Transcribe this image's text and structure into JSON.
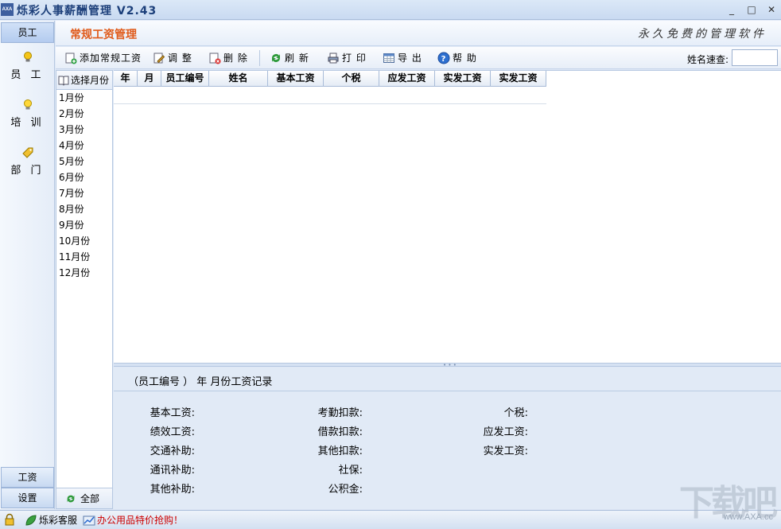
{
  "app": {
    "logo_text": "AXA",
    "title": "烁彩人事薪酬管理 V2.43",
    "minimize": "_",
    "restore": "□",
    "close": "✕"
  },
  "leftnav": {
    "top_group": "员工",
    "items": [
      {
        "label": "员 工",
        "icon": "person-bulb-icon"
      },
      {
        "label": "培 训",
        "icon": "bulb-icon"
      },
      {
        "label": "部 门",
        "icon": "tag-icon"
      }
    ],
    "bottom_groups": [
      "工资",
      "设置"
    ]
  },
  "module": {
    "title": "常规工资管理",
    "slogan": "永久免费的管理软件"
  },
  "toolbar": {
    "buttons": [
      {
        "label": "添加常规工资",
        "icon": "add-document-icon"
      },
      {
        "label": "调 整",
        "icon": "edit-icon"
      },
      {
        "label": "删 除",
        "icon": "delete-icon"
      },
      {
        "label": "刷 新",
        "icon": "refresh-icon"
      },
      {
        "label": "打 印",
        "icon": "printer-icon"
      },
      {
        "label": "导 出",
        "icon": "export-icon"
      },
      {
        "label": "帮 助",
        "icon": "help-icon"
      }
    ],
    "search_label": "姓名速查:",
    "search_value": ""
  },
  "months": {
    "header": "选择月份",
    "items": [
      "1月份",
      "2月份",
      "3月份",
      "4月份",
      "5月份",
      "6月份",
      "7月份",
      "8月份",
      "9月份",
      "10月份",
      "11月份",
      "12月份"
    ],
    "all_label": "全部"
  },
  "grid": {
    "columns": [
      "年",
      "月",
      "员工编号",
      "姓名",
      "基本工资",
      "个税",
      "应发工资",
      "实发工资",
      "实发工资"
    ],
    "rows": []
  },
  "detail": {
    "title": "（员工编号 ） 年 月份工资记录",
    "fields": [
      {
        "label": "基本工资:",
        "value": ""
      },
      {
        "label": "考勤扣款:",
        "value": ""
      },
      {
        "label": "个税:",
        "value": ""
      },
      {
        "label": "绩效工资:",
        "value": ""
      },
      {
        "label": "借款扣款:",
        "value": ""
      },
      {
        "label": "应发工资:",
        "value": ""
      },
      {
        "label": "交通补助:",
        "value": ""
      },
      {
        "label": "其他扣款:",
        "value": ""
      },
      {
        "label": "实发工资:",
        "value": ""
      },
      {
        "label": "通讯补助:",
        "value": ""
      },
      {
        "label": "社保:",
        "value": ""
      },
      {
        "label": "其他补助:",
        "value": ""
      },
      {
        "label": "公积金:",
        "value": ""
      }
    ]
  },
  "statusbar": {
    "service": "烁彩客服",
    "promo": "办公用品特价抢购！"
  },
  "watermark": {
    "big": "下载吧",
    "site": "www.AXA.cc"
  },
  "colors": {
    "module_title": "#e05a1a",
    "promo": "#cc0000",
    "accent": "#1c3f7a"
  }
}
